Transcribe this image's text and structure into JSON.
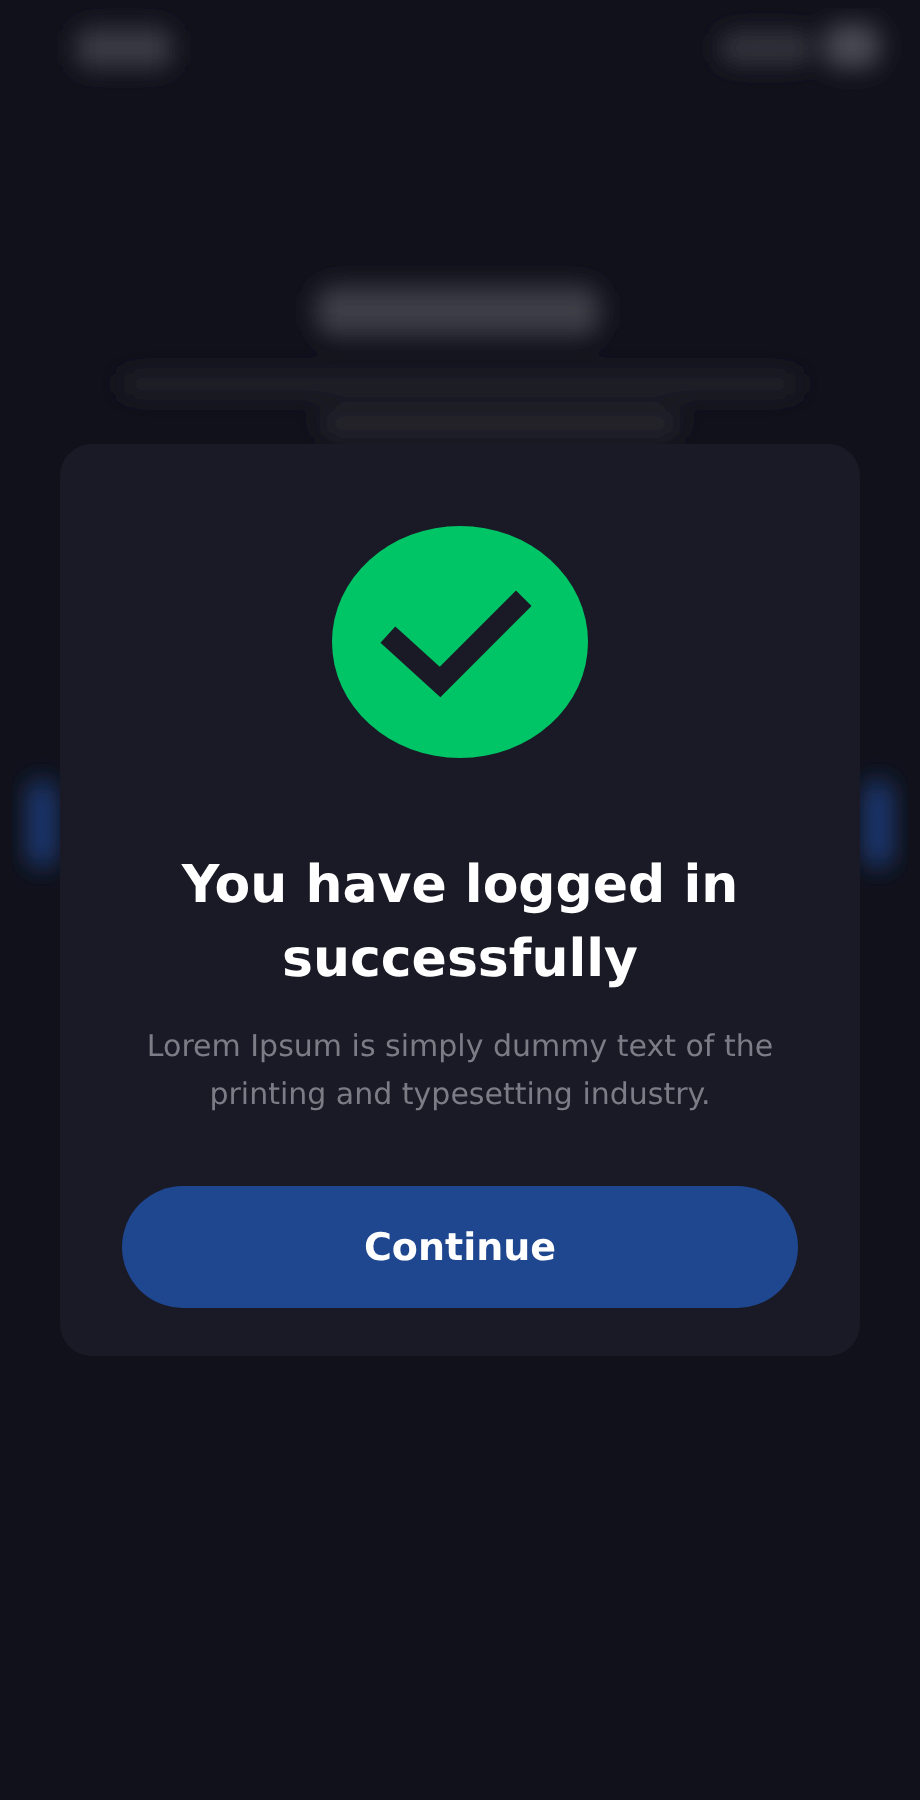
{
  "dialog": {
    "title": "You have logged in successfully",
    "message": "Lorem Ipsum is simply dummy text of the printing and typesetting industry.",
    "button": "Continue"
  }
}
